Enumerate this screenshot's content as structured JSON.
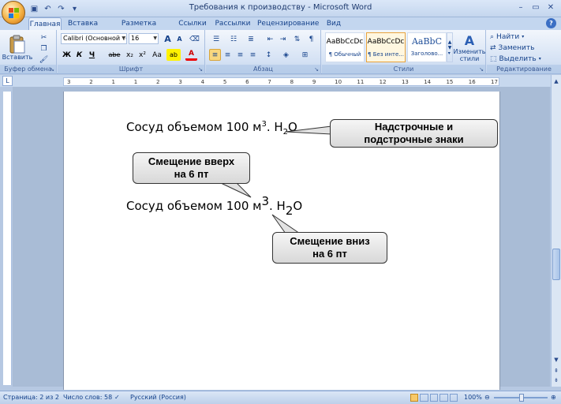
{
  "window": {
    "title": "Требования к производству - Microsoft Word",
    "controls": [
      "–",
      "▭",
      "✕"
    ]
  },
  "qat": [
    "save-icon",
    "undo-icon",
    "redo-icon",
    "dropdown-icon"
  ],
  "tabs": [
    {
      "label": "Главная",
      "active": true
    },
    {
      "label": "Вставка"
    },
    {
      "label": "Разметка страницы"
    },
    {
      "label": "Ссылки"
    },
    {
      "label": "Рассылки"
    },
    {
      "label": "Рецензирование"
    },
    {
      "label": "Вид"
    }
  ],
  "ribbon": {
    "clipboard": {
      "label": "Буфер обмена",
      "paste": "Вставить"
    },
    "font": {
      "label": "Шрифт",
      "font_name": "Calibri (Основной те",
      "font_size": "16",
      "grow": "A",
      "shrink": "A",
      "bold": "Ж",
      "italic": "К",
      "underline": "Ч",
      "strike": "abe",
      "sub": "x₂",
      "sup": "x²",
      "case": "Aa",
      "highlight": "ab",
      "color": "A"
    },
    "paragraph": {
      "label": "Абзац"
    },
    "styles": {
      "label": "Стили",
      "change": "Изменить стили",
      "items": [
        {
          "sample": "AaBbCcDc",
          "name": "¶ Обычный"
        },
        {
          "sample": "AaBbCcDc",
          "name": "¶ Без инте...",
          "selected": true
        },
        {
          "sample": "AaBbC",
          "name": "Заголово..."
        }
      ]
    },
    "editing": {
      "label": "Редактирование",
      "find": "Найти",
      "replace": "Заменить",
      "select": "Выделить"
    }
  },
  "ruler": {
    "marks": [
      "3",
      "2",
      "1",
      "1",
      "2",
      "3",
      "4",
      "5",
      "6",
      "7",
      "8",
      "9",
      "10",
      "11",
      "12",
      "13",
      "14",
      "15",
      "16",
      "17"
    ]
  },
  "document": {
    "line1": {
      "text": "Сосуд объемом 100 м",
      "sup": "3",
      "mid": ". H",
      "sub": "2",
      "end": "O"
    },
    "line2": {
      "text": "Сосуд объемом 100 м",
      "sup": "3",
      "mid": ". H",
      "sub": "2",
      "end": "O"
    }
  },
  "callouts": {
    "a": [
      "Надстрочные и",
      "подстрочные знаки"
    ],
    "b": [
      "Смещение вверх",
      "на  6 пт"
    ],
    "c": [
      "Смещение вниз",
      "на  6 пт"
    ]
  },
  "status": {
    "page": "Страница: 2 из 2",
    "words": "Число слов: 58",
    "lang": "Русский (Россия)",
    "zoom": "100%"
  }
}
